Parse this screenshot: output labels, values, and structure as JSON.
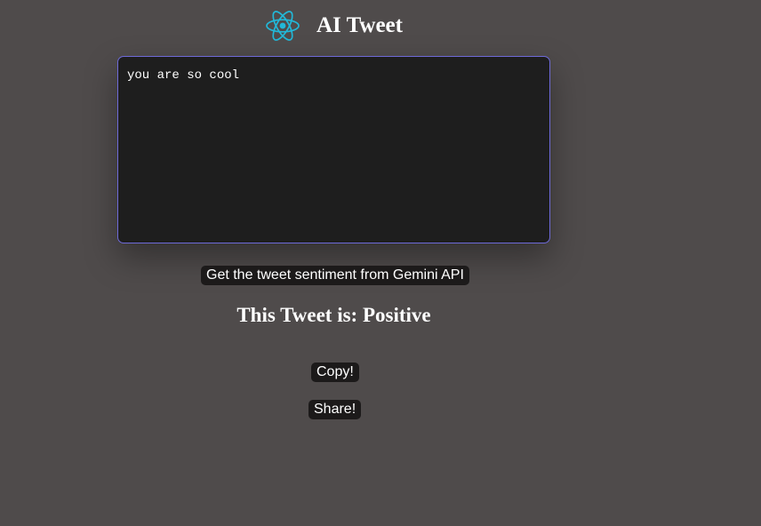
{
  "header": {
    "title": "AI Tweet",
    "logo_icon": "react-atom-icon",
    "logo_color": "#22b8d8"
  },
  "tweet_input": {
    "value": "you are so cool",
    "placeholder": ""
  },
  "analyze_button": {
    "label": "Get the tweet sentiment from Gemini API"
  },
  "result": {
    "prefix": "This Tweet is: ",
    "sentiment": "Positive"
  },
  "actions": {
    "copy_label": "Copy!",
    "share_label": "Share!"
  },
  "colors": {
    "background": "#4f4b4b",
    "textarea_bg": "#1e1e1e",
    "textarea_border": "#6e6ad9",
    "button_bg": "#1c1a1a"
  }
}
